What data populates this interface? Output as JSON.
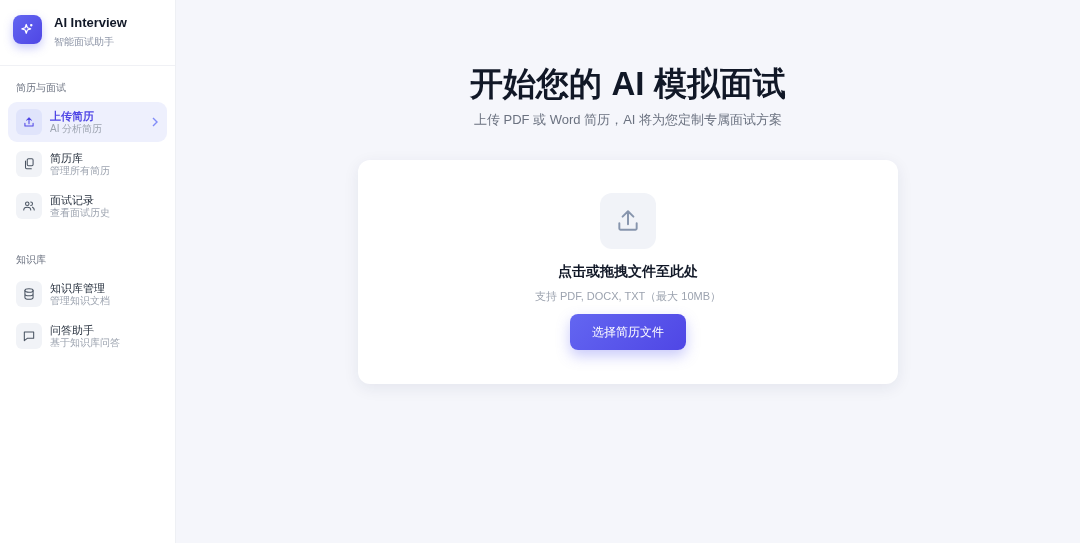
{
  "app": {
    "title": "AI Interview",
    "subtitle": "智能面试助手"
  },
  "sidebar": {
    "sections": [
      {
        "heading": "简历与面试",
        "items": [
          {
            "label": "上传简历",
            "description": "AI 分析简历",
            "selected": true
          },
          {
            "label": "简历库",
            "description": "管理所有简历",
            "selected": false
          },
          {
            "label": "面试记录",
            "description": "查看面试历史",
            "selected": false
          }
        ]
      },
      {
        "heading": "知识库",
        "items": [
          {
            "label": "知识库管理",
            "description": "管理知识文档",
            "selected": false
          },
          {
            "label": "问答助手",
            "description": "基于知识库问答",
            "selected": false
          }
        ]
      }
    ]
  },
  "main": {
    "title": "开始您的 AI 模拟面试",
    "subtitle": "上传 PDF 或 Word 简历，AI 将为您定制专属面试方案",
    "upload": {
      "prompt": "点击或拖拽文件至此处",
      "hint": "支持 PDF, DOCX, TXT（最大 10MB）",
      "button": "选择简历文件"
    }
  }
}
